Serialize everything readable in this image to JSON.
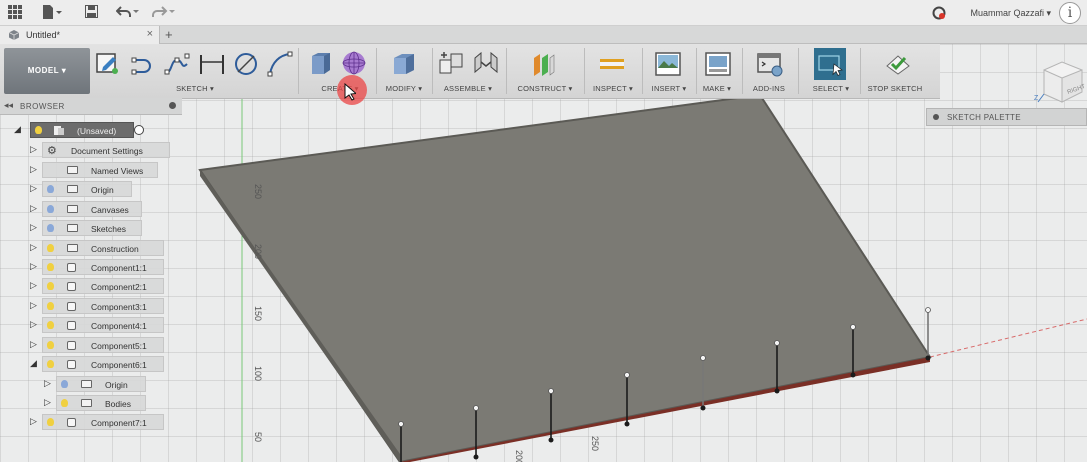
{
  "titlebar": {
    "user_name": "Muammar Qazzafi ▾",
    "info_label": "i"
  },
  "tab": {
    "title": "Untitled*",
    "close_label": "×",
    "new_tab_label": "+"
  },
  "toolbar": {
    "workspace": "MODEL ▾",
    "groups": {
      "sketch": "SKETCH ▾",
      "create": "CREATE ▾",
      "modify": "MODIFY ▾",
      "assemble": "ASSEMBLE ▾",
      "construct": "CONSTRUCT ▾",
      "inspect": "INSPECT ▾",
      "insert": "INSERT ▾",
      "make": "MAKE ▾",
      "addins": "ADD-INS",
      "select": "SELECT ▾",
      "stop_sketch": "STOP SKETCH"
    }
  },
  "browser": {
    "title": "BROWSER",
    "root": "(Unsaved)",
    "items": [
      {
        "label": "Document Settings"
      },
      {
        "label": "Named Views"
      },
      {
        "label": "Origin"
      },
      {
        "label": "Canvases"
      },
      {
        "label": "Sketches"
      },
      {
        "label": "Construction"
      },
      {
        "label": "Component1:1"
      },
      {
        "label": "Component2:1"
      },
      {
        "label": "Component3:1"
      },
      {
        "label": "Component4:1"
      },
      {
        "label": "Component5:1"
      },
      {
        "label": "Component6:1"
      },
      {
        "label": "Origin"
      },
      {
        "label": "Bodies"
      },
      {
        "label": "Component7:1"
      }
    ]
  },
  "sketch_palette": {
    "title": "SKETCH PALETTE"
  },
  "viewport": {
    "ruler_labels": [
      "250",
      "200",
      "150",
      "100",
      "50"
    ],
    "bottom_labels": [
      "250",
      "200"
    ]
  },
  "viewcube": {
    "face_label": "RIGHT",
    "axis_label": "Z"
  },
  "colors": {
    "plate": "#7b7a74",
    "plate_edge": "#5b5a55",
    "red_edge": "#7a2f26",
    "workspace_btn": "#7d8389",
    "select_btn": "#2f6f8f"
  }
}
